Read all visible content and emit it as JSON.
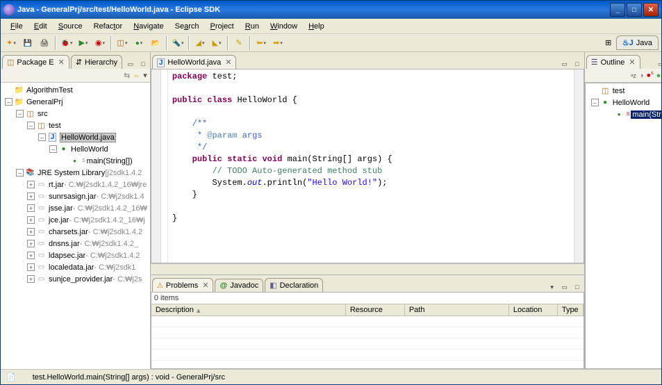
{
  "window": {
    "title": "Java - GeneralPrj/src/test/HelloWorld.java - Eclipse SDK"
  },
  "menu": {
    "file": "File",
    "edit": "Edit",
    "source": "Source",
    "refactor": "Refactor",
    "navigate": "Navigate",
    "search": "Search",
    "project": "Project",
    "run": "Run",
    "window": "Window",
    "help": "Help"
  },
  "perspective": {
    "java": "Java"
  },
  "package_explorer": {
    "tab_label": "Package E",
    "hierarchy_tab": "Hierarchy",
    "nodes": {
      "algorithm_test": "AlgorithmTest",
      "general_prj": "GeneralPrj",
      "src": "src",
      "test_pkg": "test",
      "hello_java": "HelloWorld.java",
      "hello_class": "HelloWorld",
      "main_method": "main(String[])",
      "jre": "JRE System Library",
      "jre_decor": "[j2sdk1.4.2",
      "rt": "rt.jar",
      "rt_path": " - C:₩j2sdk1.4.2_16₩jre",
      "sunrsa": "sunrsasign.jar",
      "sunrsa_path": " - C:₩j2sdk1.4",
      "jsse": "jsse.jar",
      "jsse_path": " - C:₩j2sdk1.4.2_16₩",
      "jce": "jce.jar",
      "jce_path": " - C:₩j2sdk1.4.2_16₩j",
      "charsets": "charsets.jar",
      "charsets_path": " - C:₩j2sdk1.4.2",
      "dnsns": "dnsns.jar",
      "dnsns_path": " - C:₩j2sdk1.4.2_",
      "ldap": "ldapsec.jar",
      "ldap_path": " - C:₩j2sdk1.4.2",
      "locale": "localedata.jar",
      "locale_path": " - C:₩j2sdk1",
      "sunjce": "sunjce_provider.jar",
      "sunjce_path": " - C:₩j2s"
    }
  },
  "editor": {
    "tab": "HelloWorld.java",
    "code": {
      "l1a": "package",
      "l1b": " test;",
      "l3a": "public",
      "l3b": " ",
      "l3c": "class",
      "l3d": " HelloWorld {",
      "l5": "    /**",
      "l6a": "     * ",
      "l6b": "@param",
      "l6c": " args",
      "l7": "     */",
      "l8a": "    ",
      "l8b": "public",
      "l8c": " ",
      "l8d": "static",
      "l8e": " ",
      "l8f": "void",
      "l8g": " main(String[] args) {",
      "l9a": "        ",
      "l9b": "// TODO Auto-generated method stub",
      "l10a": "        System.",
      "l10b": "out",
      "l10c": ".println(",
      "l10d": "\"Hello World!\"",
      "l10e": ");",
      "l11": "    }",
      "l13": "}"
    }
  },
  "problems": {
    "tab": "Problems",
    "javadoc_tab": "Javadoc",
    "declaration_tab": "Declaration",
    "items_count": "0 items",
    "cols": {
      "desc": "Description",
      "res": "Resource",
      "path": "Path",
      "loc": "Location",
      "type": "Type"
    }
  },
  "outline": {
    "tab": "Outline",
    "test": "test",
    "hello": "HelloWorld",
    "main": "main(String[])"
  },
  "status": {
    "element": "test.HelloWorld.main(String[] args) : void - GeneralPrj/src"
  }
}
